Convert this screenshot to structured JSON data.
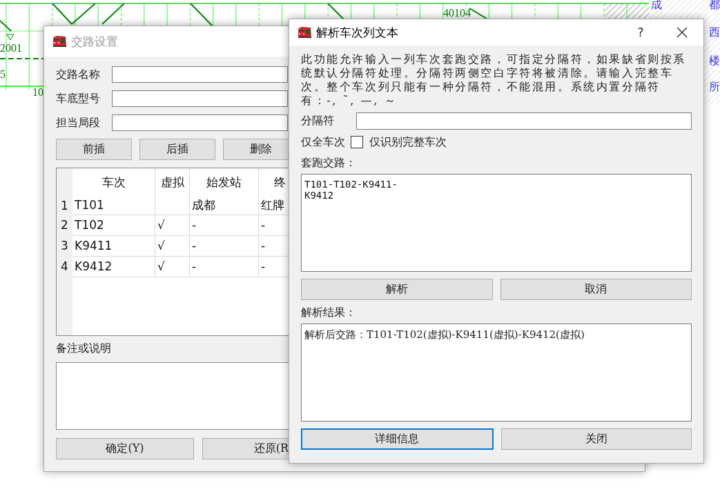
{
  "background": {
    "labels": [
      {
        "text": "2001",
        "kind": "train"
      },
      {
        "text": "5",
        "kind": "train"
      },
      {
        "text": "10",
        "kind": "train"
      },
      {
        "text": "40104",
        "kind": "train"
      },
      {
        "text": "成",
        "kind": "station"
      },
      {
        "text": "都",
        "kind": "station"
      },
      {
        "text": "西",
        "kind": "station"
      },
      {
        "text": "楼",
        "kind": "station"
      },
      {
        "text": "所",
        "kind": "station"
      }
    ]
  },
  "route_dialog": {
    "title": "交路设置",
    "active": false,
    "fields": [
      {
        "label": "交路名称"
      },
      {
        "label": "车底型号"
      },
      {
        "label": "担当局段"
      }
    ],
    "buttons": [
      "前插",
      "后插",
      "删除"
    ],
    "table": {
      "columns": [
        "车次",
        "虚拟",
        "始发站",
        "终"
      ],
      "rows": [
        {
          "number": "1",
          "train": "T101",
          "origin": "成都",
          "terminal": "红牌"
        },
        {
          "number": "2",
          "train": "T102",
          "virtual": "√",
          "origin": "-",
          "terminal": "-"
        },
        {
          "number": "3",
          "train": "K9411",
          "virtual": "√",
          "origin": "-",
          "terminal": "-"
        },
        {
          "number": "4",
          "train": "K9412",
          "virtual": "√",
          "origin": "-",
          "terminal": "-"
        }
      ]
    },
    "notes_label": "备注或说明",
    "bottom_buttons": [
      "确定(Y)",
      "还原(R"
    ]
  },
  "parse_dialog": {
    "title": "解析车次列文本",
    "active": true,
    "help": "?",
    "description": "此功能允许输入一列车次套跑交路，可指定分隔符，如果缺省则按系统默认分隔符处理。分隔符两侧空白字符将被清除。请输入完整车次。整个车次列只能有一种分隔符，不能混用。系统内置分隔符有：-, ˜, —, ～",
    "separator_label": "分隔符",
    "full_only": {
      "label": "仅全车次",
      "checked": false,
      "text": "仅识别完整车次"
    },
    "route_label": "套跑交路：",
    "route_text": "T101-T102-K9411-\nK9412",
    "buttons": [
      {
        "label": "解析",
        "focused": false
      },
      {
        "label": "取消",
        "focused": false
      }
    ],
    "result_label": "解析结果：",
    "result_text": "解析后交路：T101-T102(虚拟)-K9411(虚拟)-K9412(虚拟)",
    "bottom_buttons": [
      {
        "label": "详细信息",
        "focused": true
      },
      {
        "label": "关闭",
        "focused": false
      }
    ]
  }
}
